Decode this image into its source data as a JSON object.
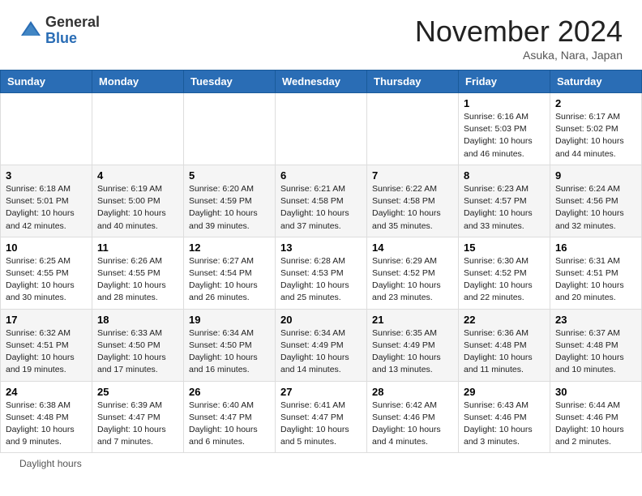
{
  "header": {
    "logo_general": "General",
    "logo_blue": "Blue",
    "month_title": "November 2024",
    "subtitle": "Asuka, Nara, Japan"
  },
  "footer": {
    "daylight_label": "Daylight hours"
  },
  "days_of_week": [
    "Sunday",
    "Monday",
    "Tuesday",
    "Wednesday",
    "Thursday",
    "Friday",
    "Saturday"
  ],
  "weeks": [
    [
      {
        "day": "",
        "sunrise": "",
        "sunset": "",
        "daylight": ""
      },
      {
        "day": "",
        "sunrise": "",
        "sunset": "",
        "daylight": ""
      },
      {
        "day": "",
        "sunrise": "",
        "sunset": "",
        "daylight": ""
      },
      {
        "day": "",
        "sunrise": "",
        "sunset": "",
        "daylight": ""
      },
      {
        "day": "",
        "sunrise": "",
        "sunset": "",
        "daylight": ""
      },
      {
        "day": "1",
        "sunrise": "Sunrise: 6:16 AM",
        "sunset": "Sunset: 5:03 PM",
        "daylight": "Daylight: 10 hours and 46 minutes."
      },
      {
        "day": "2",
        "sunrise": "Sunrise: 6:17 AM",
        "sunset": "Sunset: 5:02 PM",
        "daylight": "Daylight: 10 hours and 44 minutes."
      }
    ],
    [
      {
        "day": "3",
        "sunrise": "Sunrise: 6:18 AM",
        "sunset": "Sunset: 5:01 PM",
        "daylight": "Daylight: 10 hours and 42 minutes."
      },
      {
        "day": "4",
        "sunrise": "Sunrise: 6:19 AM",
        "sunset": "Sunset: 5:00 PM",
        "daylight": "Daylight: 10 hours and 40 minutes."
      },
      {
        "day": "5",
        "sunrise": "Sunrise: 6:20 AM",
        "sunset": "Sunset: 4:59 PM",
        "daylight": "Daylight: 10 hours and 39 minutes."
      },
      {
        "day": "6",
        "sunrise": "Sunrise: 6:21 AM",
        "sunset": "Sunset: 4:58 PM",
        "daylight": "Daylight: 10 hours and 37 minutes."
      },
      {
        "day": "7",
        "sunrise": "Sunrise: 6:22 AM",
        "sunset": "Sunset: 4:58 PM",
        "daylight": "Daylight: 10 hours and 35 minutes."
      },
      {
        "day": "8",
        "sunrise": "Sunrise: 6:23 AM",
        "sunset": "Sunset: 4:57 PM",
        "daylight": "Daylight: 10 hours and 33 minutes."
      },
      {
        "day": "9",
        "sunrise": "Sunrise: 6:24 AM",
        "sunset": "Sunset: 4:56 PM",
        "daylight": "Daylight: 10 hours and 32 minutes."
      }
    ],
    [
      {
        "day": "10",
        "sunrise": "Sunrise: 6:25 AM",
        "sunset": "Sunset: 4:55 PM",
        "daylight": "Daylight: 10 hours and 30 minutes."
      },
      {
        "day": "11",
        "sunrise": "Sunrise: 6:26 AM",
        "sunset": "Sunset: 4:55 PM",
        "daylight": "Daylight: 10 hours and 28 minutes."
      },
      {
        "day": "12",
        "sunrise": "Sunrise: 6:27 AM",
        "sunset": "Sunset: 4:54 PM",
        "daylight": "Daylight: 10 hours and 26 minutes."
      },
      {
        "day": "13",
        "sunrise": "Sunrise: 6:28 AM",
        "sunset": "Sunset: 4:53 PM",
        "daylight": "Daylight: 10 hours and 25 minutes."
      },
      {
        "day": "14",
        "sunrise": "Sunrise: 6:29 AM",
        "sunset": "Sunset: 4:52 PM",
        "daylight": "Daylight: 10 hours and 23 minutes."
      },
      {
        "day": "15",
        "sunrise": "Sunrise: 6:30 AM",
        "sunset": "Sunset: 4:52 PM",
        "daylight": "Daylight: 10 hours and 22 minutes."
      },
      {
        "day": "16",
        "sunrise": "Sunrise: 6:31 AM",
        "sunset": "Sunset: 4:51 PM",
        "daylight": "Daylight: 10 hours and 20 minutes."
      }
    ],
    [
      {
        "day": "17",
        "sunrise": "Sunrise: 6:32 AM",
        "sunset": "Sunset: 4:51 PM",
        "daylight": "Daylight: 10 hours and 19 minutes."
      },
      {
        "day": "18",
        "sunrise": "Sunrise: 6:33 AM",
        "sunset": "Sunset: 4:50 PM",
        "daylight": "Daylight: 10 hours and 17 minutes."
      },
      {
        "day": "19",
        "sunrise": "Sunrise: 6:34 AM",
        "sunset": "Sunset: 4:50 PM",
        "daylight": "Daylight: 10 hours and 16 minutes."
      },
      {
        "day": "20",
        "sunrise": "Sunrise: 6:34 AM",
        "sunset": "Sunset: 4:49 PM",
        "daylight": "Daylight: 10 hours and 14 minutes."
      },
      {
        "day": "21",
        "sunrise": "Sunrise: 6:35 AM",
        "sunset": "Sunset: 4:49 PM",
        "daylight": "Daylight: 10 hours and 13 minutes."
      },
      {
        "day": "22",
        "sunrise": "Sunrise: 6:36 AM",
        "sunset": "Sunset: 4:48 PM",
        "daylight": "Daylight: 10 hours and 11 minutes."
      },
      {
        "day": "23",
        "sunrise": "Sunrise: 6:37 AM",
        "sunset": "Sunset: 4:48 PM",
        "daylight": "Daylight: 10 hours and 10 minutes."
      }
    ],
    [
      {
        "day": "24",
        "sunrise": "Sunrise: 6:38 AM",
        "sunset": "Sunset: 4:48 PM",
        "daylight": "Daylight: 10 hours and 9 minutes."
      },
      {
        "day": "25",
        "sunrise": "Sunrise: 6:39 AM",
        "sunset": "Sunset: 4:47 PM",
        "daylight": "Daylight: 10 hours and 7 minutes."
      },
      {
        "day": "26",
        "sunrise": "Sunrise: 6:40 AM",
        "sunset": "Sunset: 4:47 PM",
        "daylight": "Daylight: 10 hours and 6 minutes."
      },
      {
        "day": "27",
        "sunrise": "Sunrise: 6:41 AM",
        "sunset": "Sunset: 4:47 PM",
        "daylight": "Daylight: 10 hours and 5 minutes."
      },
      {
        "day": "28",
        "sunrise": "Sunrise: 6:42 AM",
        "sunset": "Sunset: 4:46 PM",
        "daylight": "Daylight: 10 hours and 4 minutes."
      },
      {
        "day": "29",
        "sunrise": "Sunrise: 6:43 AM",
        "sunset": "Sunset: 4:46 PM",
        "daylight": "Daylight: 10 hours and 3 minutes."
      },
      {
        "day": "30",
        "sunrise": "Sunrise: 6:44 AM",
        "sunset": "Sunset: 4:46 PM",
        "daylight": "Daylight: 10 hours and 2 minutes."
      }
    ]
  ]
}
